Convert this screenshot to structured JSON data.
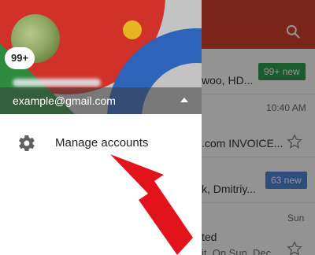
{
  "background_inbox": {
    "rows": [
      {
        "text": "woo, HD...",
        "badge": "99+ new",
        "badge_color": "#2e9d54"
      },
      {
        "time": "10:40 AM",
        "text": ".com INVOICE..."
      },
      {
        "text": "k, Dmitriy...",
        "badge": "63 new",
        "badge_color": "#4e86d6"
      },
      {
        "time": "Sun",
        "text": "ted",
        "snippet": "it. On Sun. Dec..."
      }
    ],
    "toolbar_color": "#d23f31",
    "search_icon": "search-icon",
    "star_icon": "star-outline-icon"
  },
  "drawer": {
    "unread_badge": "99+",
    "account_email": "example@gmail.com",
    "toggle_icon": "triangle-up-icon",
    "menu": {
      "icon": "gear-icon",
      "label": "Manage accounts"
    }
  },
  "annotation": {
    "arrow_color": "#e3131b",
    "icon": "arrow-annotation"
  }
}
